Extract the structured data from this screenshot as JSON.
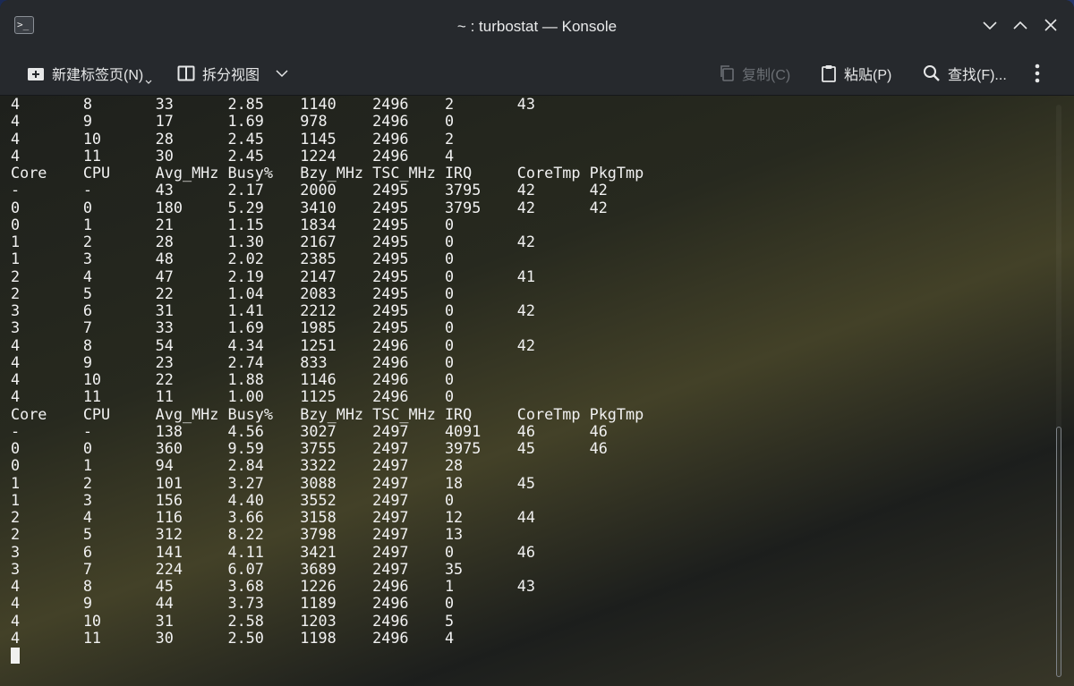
{
  "window": {
    "title": "~ : turbostat — Konsole",
    "app_icon_glyph": ">_"
  },
  "toolbar": {
    "new_tab_label": "新建标签页(N)",
    "split_view_label": "拆分视图",
    "copy_label": "复制(C)",
    "paste_label": "粘贴(P)",
    "find_label": "查找(F)..."
  },
  "colors": {
    "titlebar": "#26292d",
    "text": "#f1f1f1",
    "disabled_text": "#6b6f74"
  },
  "terminal": {
    "lines": [
      "4       8       33      2.85    1140    2496    2       43",
      "4       9       17      1.69    978     2496    0",
      "4       10      28      2.45    1145    2496    2",
      "4       11      30      2.45    1224    2496    4",
      "Core    CPU     Avg_MHz Busy%   Bzy_MHz TSC_MHz IRQ     CoreTmp PkgTmp",
      "-       -       43      2.17    2000    2495    3795    42      42",
      "0       0       180     5.29    3410    2495    3795    42      42",
      "0       1       21      1.15    1834    2495    0",
      "1       2       28      1.30    2167    2495    0       42",
      "1       3       48      2.02    2385    2495    0",
      "2       4       47      2.19    2147    2495    0       41",
      "2       5       22      1.04    2083    2495    0",
      "3       6       31      1.41    2212    2495    0       42",
      "3       7       33      1.69    1985    2495    0",
      "4       8       54      4.34    1251    2496    0       42",
      "4       9       23      2.74    833     2496    0",
      "4       10      22      1.88    1146    2496    0",
      "4       11      11      1.00    1125    2496    0",
      "Core    CPU     Avg_MHz Busy%   Bzy_MHz TSC_MHz IRQ     CoreTmp PkgTmp",
      "-       -       138     4.56    3027    2497    4091    46      46",
      "0       0       360     9.59    3755    2497    3975    45      46",
      "0       1       94      2.84    3322    2497    28",
      "1       2       101     3.27    3088    2497    18      45",
      "1       3       156     4.40    3552    2497    0",
      "2       4       116     3.66    3158    2497    12      44",
      "2       5       312     8.22    3798    2497    13",
      "3       6       141     4.11    3421    2497    0       46",
      "3       7       224     6.07    3689    2497    35",
      "4       8       45      3.68    1226    2496    1       43",
      "4       9       44      3.73    1189    2496    0",
      "4       10      31      2.58    1203    2496    5",
      "4       11      30      2.50    1198    2496    4"
    ]
  }
}
